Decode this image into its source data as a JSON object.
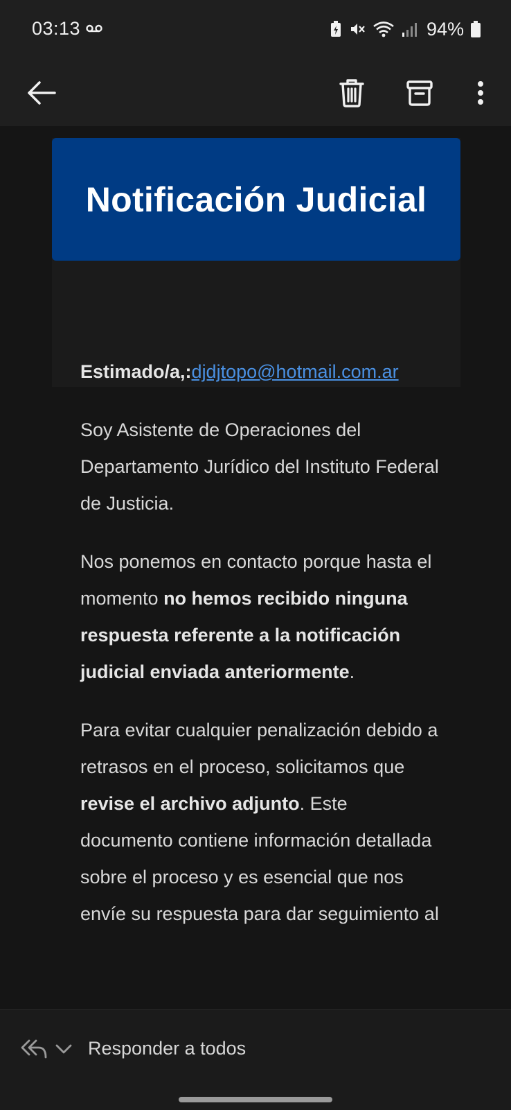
{
  "status_bar": {
    "time": "03:13",
    "battery": "94%"
  },
  "toolbar": {
    "back_icon": "arrow-left-icon",
    "delete_icon": "trash-icon",
    "archive_icon": "archive-icon",
    "more_icon": "more-vertical-icon"
  },
  "email": {
    "banner_title": "Notificación Judicial",
    "greeting_prefix": "Estimado/a,:",
    "recipient_email": "djdjtopo@hotmail.com.ar",
    "paragraph1": "Soy Asistente de Operaciones del Departamento Jurídico del Instituto Federal de Justicia.",
    "paragraph2_a": "Nos ponemos en contacto porque hasta el momento ",
    "paragraph2_bold": "no hemos recibido ninguna respuesta referente a la notificación judicial enviada anteriormente",
    "paragraph2_b": ".",
    "paragraph3_a": "Para evitar cualquier penalización debido a retrasos en el proceso, solicitamos que ",
    "paragraph3_bold": "revise el archivo adjunto",
    "paragraph3_b": ". Este documento contiene información detallada sobre el proceso y es esencial que nos envíe su respuesta para dar seguimiento al"
  },
  "reply_bar": {
    "label": "Responder a todos"
  },
  "colors": {
    "banner": "#003b84",
    "link": "#4a90e2",
    "background": "#151515"
  }
}
